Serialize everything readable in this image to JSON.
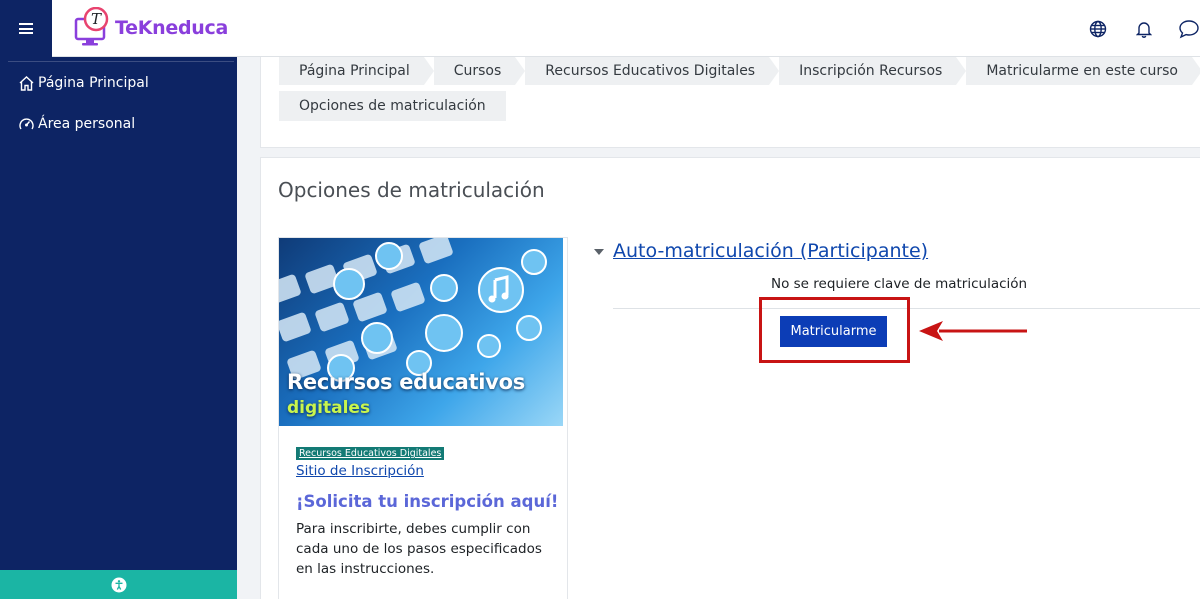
{
  "app": {
    "logo_text": "TeKneduca",
    "logo_letter": "T"
  },
  "topbar_icons": [
    "language-globe-icon",
    "notifications-bell-icon",
    "messages-chat-icon"
  ],
  "sidebar": {
    "items": [
      {
        "label": "Página Principal",
        "icon": "home-icon"
      },
      {
        "label": "Área personal",
        "icon": "dashboard-gauge-icon"
      }
    ],
    "footer_icon": "accessibility-icon"
  },
  "breadcrumb": {
    "items": [
      "Página Principal",
      "Cursos",
      "Recursos Educativos Digitales",
      "Inscripción Recursos",
      "Matricularme en este curso"
    ],
    "current": "Opciones de matriculación"
  },
  "page_title": "Opciones de matriculación",
  "course": {
    "image_title": "Recursos educativos",
    "image_subtitle": "digitales",
    "category_badge": "Recursos Educativos Digitales",
    "link": "Sitio de Inscripción",
    "cta": "¡Solicita tu inscripción aquí!",
    "description": "Para inscribirte, debes cumplir con cada uno de los pasos especificados en las instrucciones."
  },
  "enrolment": {
    "title": "Auto-matriculación (Participante)",
    "no_key": "No se requiere clave de matriculación",
    "button": "Matricularme"
  },
  "colors": {
    "sidebar": "#0d2464",
    "accent_teal": "#1bb5a4",
    "link": "#0f47ad",
    "button": "#0c3db6",
    "highlight": "#c81414",
    "logo": "#8a3fdc"
  }
}
